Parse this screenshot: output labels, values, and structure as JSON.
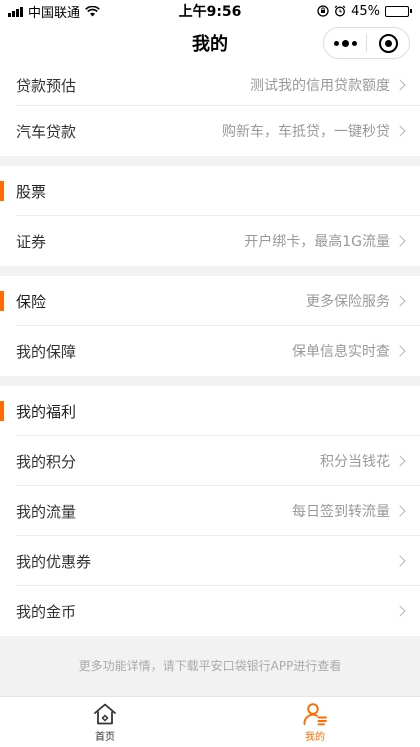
{
  "status_bar": {
    "carrier": "中国联通",
    "time": "上午9:56",
    "battery": "45%",
    "battery_level": 0.45
  },
  "nav": {
    "title": "我的"
  },
  "rows": {
    "loan_estimate": {
      "label": "贷款预估",
      "desc": "测试我的信用贷款额度"
    },
    "car_loan": {
      "label": "汽车贷款",
      "desc": "购新车，车抵贷，一键秒贷"
    },
    "stocks": {
      "label": "股票"
    },
    "securities": {
      "label": "证券",
      "desc": "开户绑卡，最高1G流量"
    },
    "insurance": {
      "label": "保险",
      "desc": "更多保险服务"
    },
    "my_coverage": {
      "label": "我的保障",
      "desc": "保单信息实时查"
    },
    "benefits": {
      "label": "我的福利"
    },
    "points": {
      "label": "我的积分",
      "desc": "积分当钱花"
    },
    "data_traffic": {
      "label": "我的流量",
      "desc": "每日签到转流量"
    },
    "coupons": {
      "label": "我的优惠券"
    },
    "coins": {
      "label": "我的金币"
    }
  },
  "footer_note": "更多功能详情，请下载平安口袋银行APP进行查看",
  "tabs": [
    {
      "label": "首页",
      "icon": "home-icon"
    },
    {
      "label": "我的",
      "icon": "user-icon"
    }
  ],
  "colors": {
    "accent": "#ff6b00"
  }
}
